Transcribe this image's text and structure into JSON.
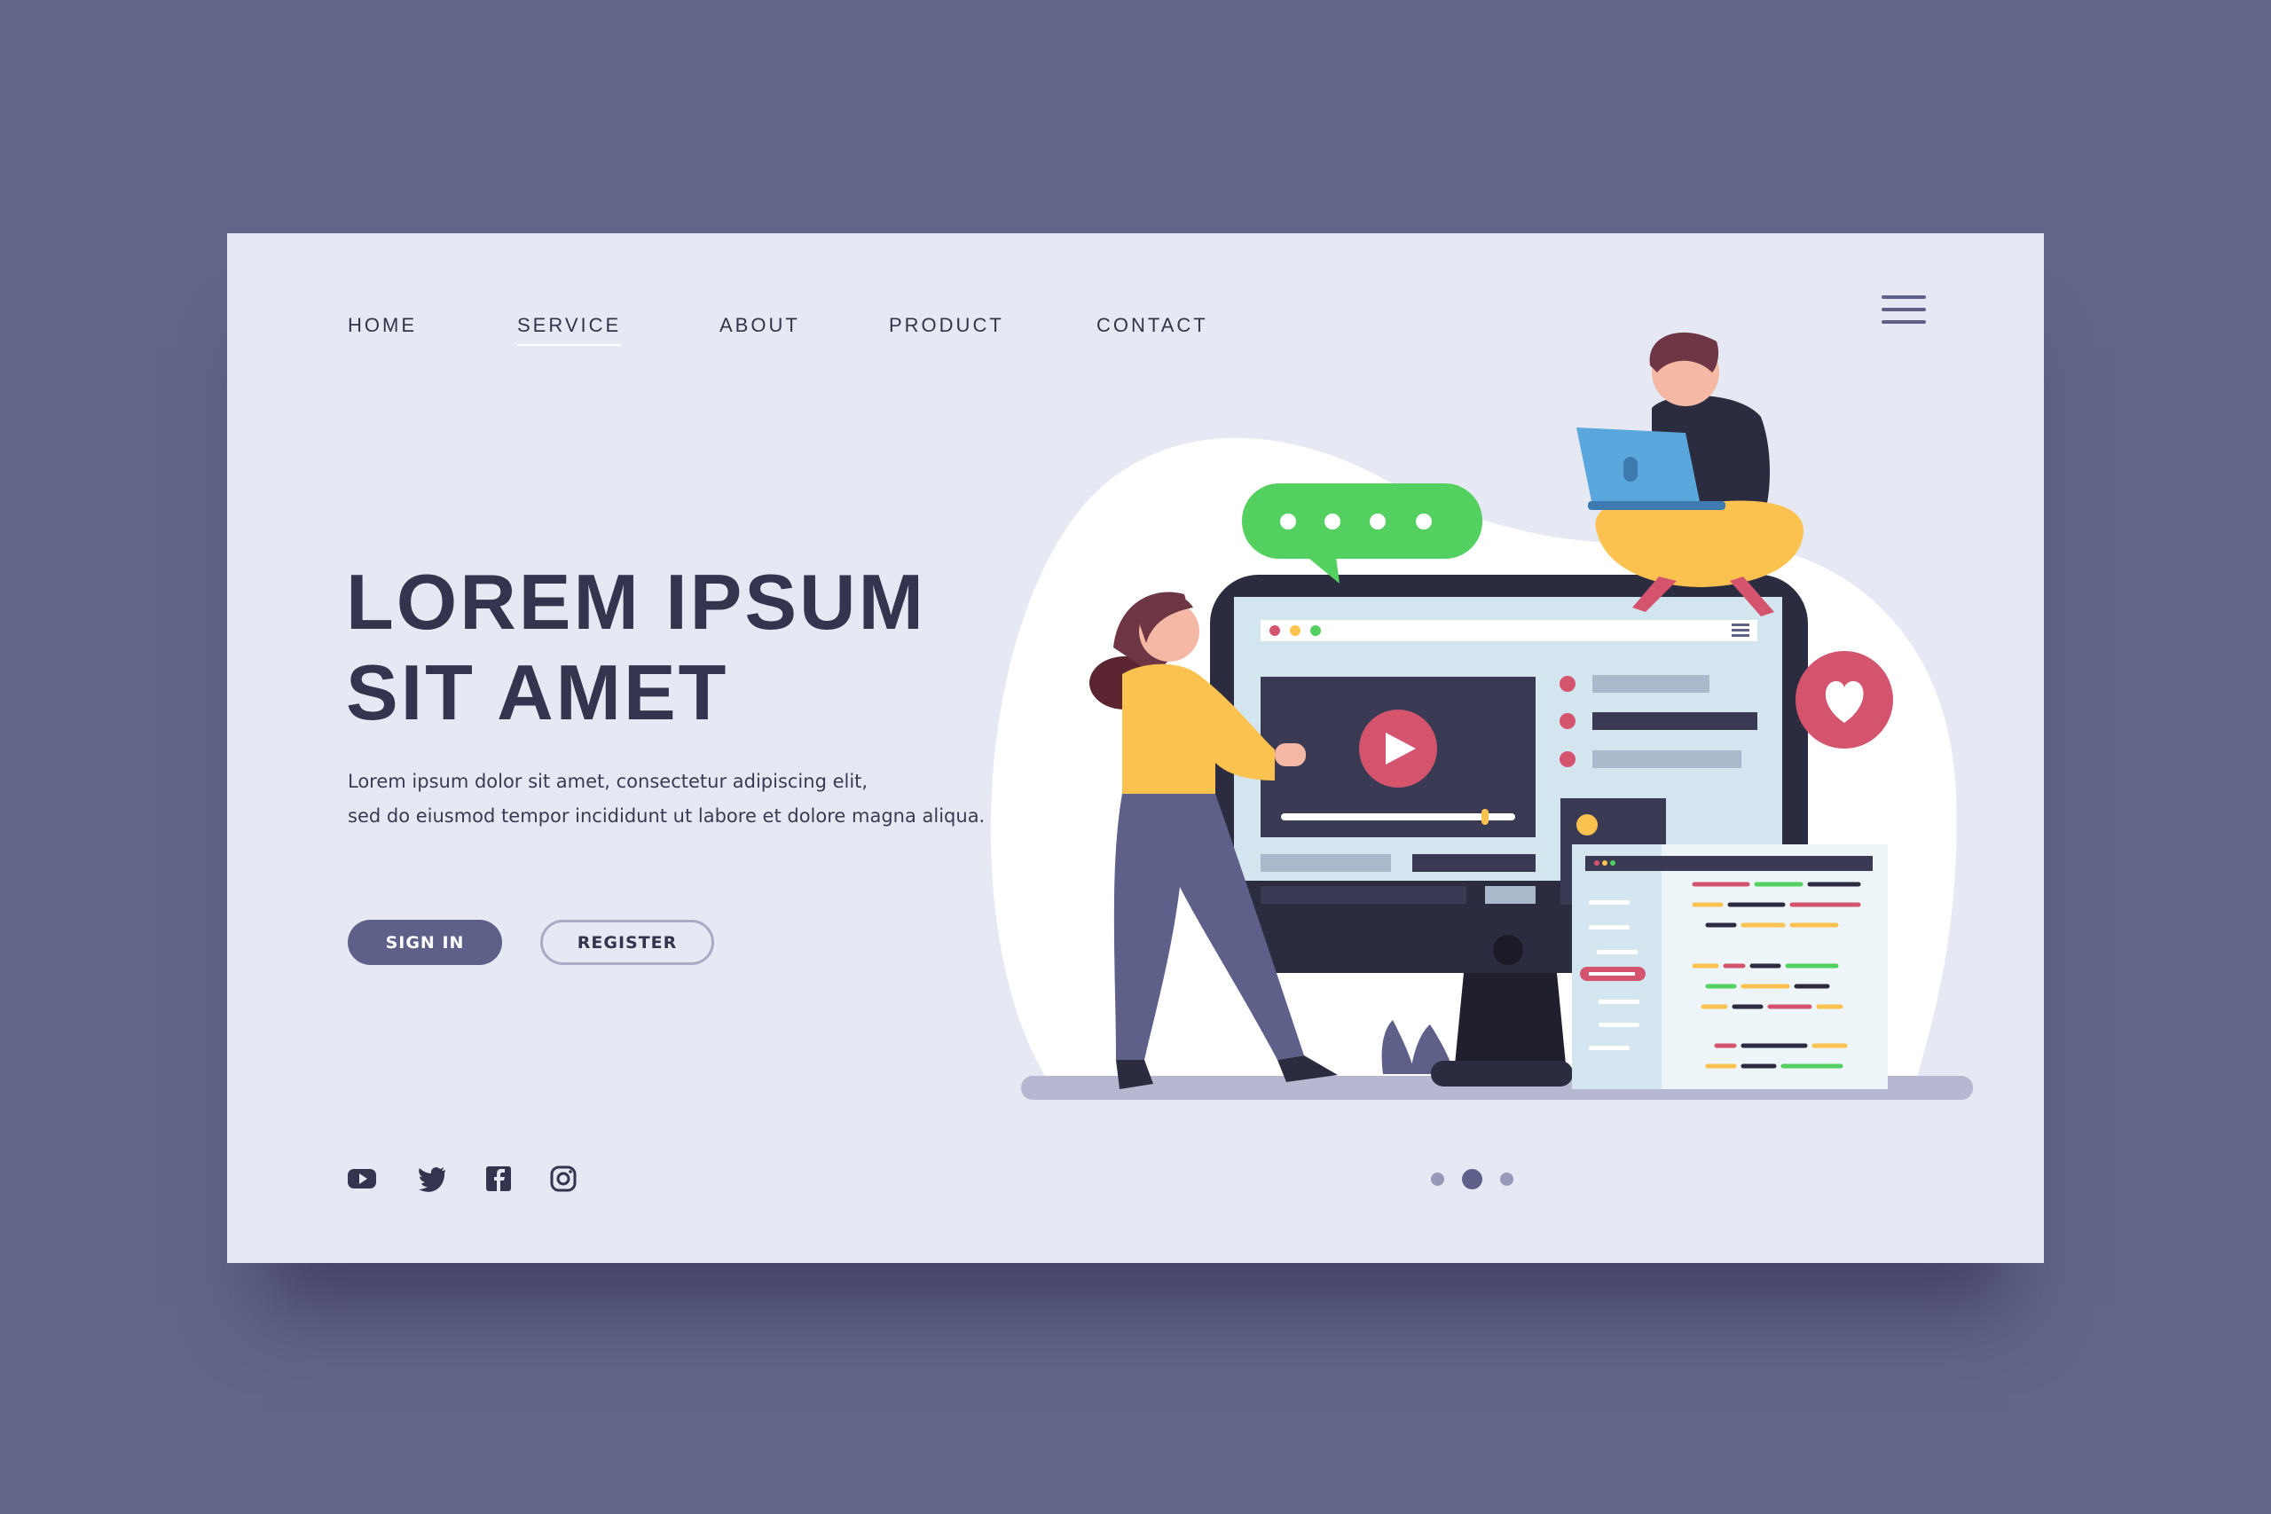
{
  "nav": {
    "items": [
      {
        "label": "HOME"
      },
      {
        "label": "SERVICE",
        "active": true
      },
      {
        "label": "ABOUT"
      },
      {
        "label": "PRODUCT"
      },
      {
        "label": "CONTACT"
      }
    ],
    "menu_icon": "hamburger-icon"
  },
  "hero": {
    "title_line1": "LOREM IPSUM",
    "title_line2": "SIT AMET",
    "para_line1": "Lorem ipsum dolor sit amet, consectetur adipiscing elit,",
    "para_line2": "sed do eiusmod tempor incididunt ut labore et dolore magna aliqua.",
    "sign_in": "SIGN IN",
    "register": "REGISTER"
  },
  "social": [
    "youtube-icon",
    "twitter-icon",
    "facebook-icon",
    "instagram-icon"
  ],
  "pagination": {
    "count": 3,
    "active": 2
  },
  "colors": {
    "background": "#62648a",
    "card": "#e6e9f3",
    "primary": "#5f6089",
    "text": "#33344d",
    "accent_red": "#d4546e",
    "accent_green": "#53d05f",
    "accent_yellow": "#fbc24f"
  }
}
